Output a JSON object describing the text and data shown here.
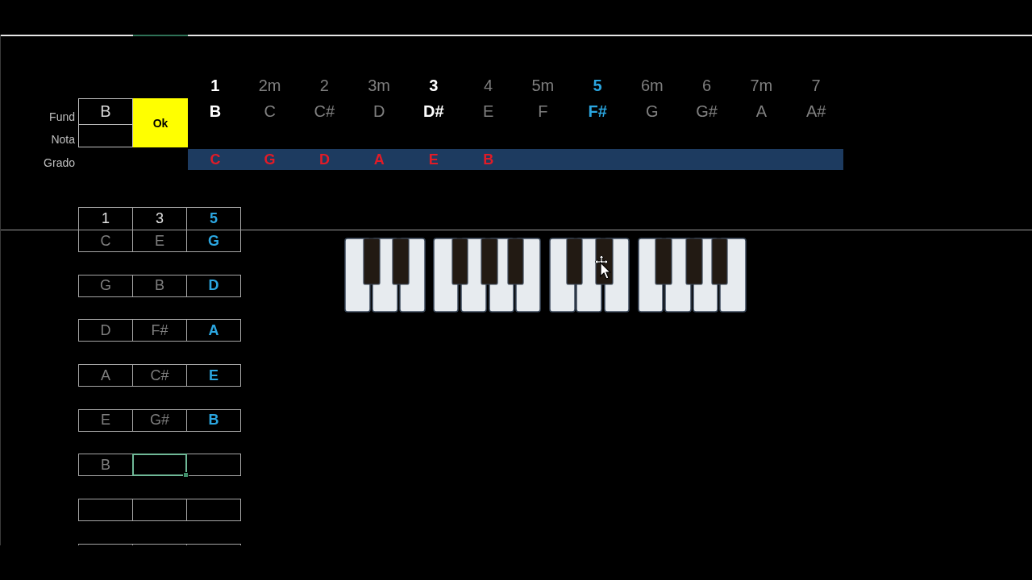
{
  "inputs": {
    "fund": {
      "label": "Fund",
      "value": "B"
    },
    "nota": {
      "label": "Nota"
    },
    "ok_button": "Ok"
  },
  "grado_label": "Grado",
  "scale": [
    {
      "degree": "1",
      "note": "B",
      "kind": "chord"
    },
    {
      "degree": "2m",
      "note": "C",
      "kind": "plain"
    },
    {
      "degree": "2",
      "note": "C#",
      "kind": "plain"
    },
    {
      "degree": "3m",
      "note": "D",
      "kind": "plain"
    },
    {
      "degree": "3",
      "note": "D#",
      "kind": "chord"
    },
    {
      "degree": "4",
      "note": "E",
      "kind": "plain"
    },
    {
      "degree": "5m",
      "note": "F",
      "kind": "plain"
    },
    {
      "degree": "5",
      "note": "F#",
      "kind": "fifth"
    },
    {
      "degree": "6m",
      "note": "G",
      "kind": "plain"
    },
    {
      "degree": "6",
      "note": "G#",
      "kind": "plain"
    },
    {
      "degree": "7m",
      "note": "A",
      "kind": "plain"
    },
    {
      "degree": "7",
      "note": "A#",
      "kind": "plain"
    }
  ],
  "grado": [
    "C",
    "G",
    "D",
    "A",
    "E",
    "B"
  ],
  "chord_table": {
    "columns": [
      {
        "label": "1",
        "kind": "chord"
      },
      {
        "label": "3",
        "kind": "chord"
      },
      {
        "label": "5",
        "kind": "fifth"
      }
    ],
    "rows": [
      {
        "cells": [
          {
            "text": "C",
            "selected": false
          },
          {
            "text": "E",
            "selected": false
          },
          {
            "text": "G",
            "selected": false
          }
        ]
      },
      {
        "cells": [
          {
            "text": "G",
            "selected": false
          },
          {
            "text": "B",
            "selected": false
          },
          {
            "text": "D",
            "selected": false
          }
        ]
      },
      {
        "cells": [
          {
            "text": "D",
            "selected": false
          },
          {
            "text": "F#",
            "selected": false
          },
          {
            "text": "A",
            "selected": false
          }
        ]
      },
      {
        "cells": [
          {
            "text": "A",
            "selected": false
          },
          {
            "text": "C#",
            "selected": false
          },
          {
            "text": "E",
            "selected": false
          }
        ]
      },
      {
        "cells": [
          {
            "text": "E",
            "selected": false
          },
          {
            "text": "G#",
            "selected": false
          },
          {
            "text": "B",
            "selected": false
          }
        ]
      },
      {
        "cells": [
          {
            "text": "B",
            "selected": false
          },
          {
            "selected": true
          },
          {
            "selected": false
          }
        ]
      },
      {
        "cells": [
          {
            "selected": false
          },
          {
            "selected": false
          },
          {
            "selected": false
          }
        ]
      }
    ]
  }
}
